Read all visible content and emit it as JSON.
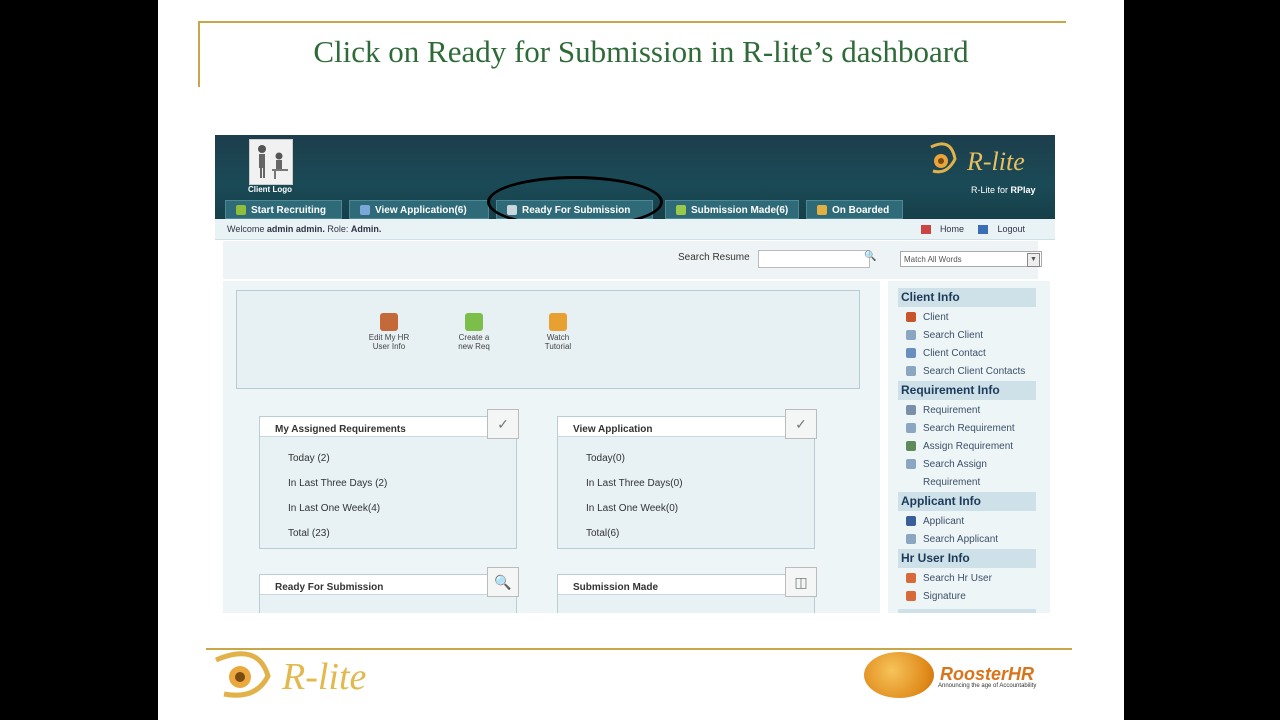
{
  "slide": {
    "title": "Click on Ready for Submission in R-lite’s dashboard"
  },
  "header": {
    "client_logo_label": "Client Logo",
    "brand_name": "R-lite",
    "brand_sub_prefix": "R-Lite for ",
    "brand_sub_bold": "RPlay"
  },
  "tabs": [
    {
      "label": "Start Recruiting",
      "icon": "start-recruiting-icon",
      "color": "#8fbf3a"
    },
    {
      "label": "View Application(6)",
      "icon": "view-application-icon",
      "color": "#7aa8d8"
    },
    {
      "label": "Ready For Submission",
      "icon": "ready-submission-icon",
      "color": "#c9d6dc"
    },
    {
      "label": "Submission Made(6)",
      "icon": "submission-made-icon",
      "color": "#9ac84a"
    },
    {
      "label": "On Boarded",
      "icon": "on-boarded-icon",
      "color": "#e0b040"
    }
  ],
  "welcome": {
    "prefix": "Welcome ",
    "user": "admin admin.",
    "role_label": " Role: ",
    "role": "Admin.",
    "home": "Home",
    "logout": "Logout"
  },
  "search": {
    "label": "Search Resume",
    "value": "",
    "match_option": "Match All Words"
  },
  "quick_links": [
    {
      "line1": "Edit My HR",
      "line2": "User Info",
      "icon": "edit-user-icon",
      "color": "#c46a3a"
    },
    {
      "line1": "Create a",
      "line2": "new Req",
      "icon": "create-req-icon",
      "color": "#7bbf4a"
    },
    {
      "line1": "Watch",
      "line2": "Tutorial",
      "icon": "tutorial-icon",
      "color": "#e8a030"
    }
  ],
  "panels": [
    {
      "title": "My Assigned Requirements",
      "icon": "check-document-icon",
      "rows": [
        "Today (2)",
        "In Last Three Days (2)",
        "In Last One Week(4)",
        "Total (23)"
      ]
    },
    {
      "title": "View Application",
      "icon": "check-icon",
      "rows": [
        "Today(0)",
        "In Last Three Days(0)",
        "In Last One Week(0)",
        "Total(6)"
      ]
    },
    {
      "title": "Ready For Submission",
      "icon": "magnifier-document-icon",
      "rows": []
    },
    {
      "title": "Submission Made",
      "icon": "documents-icon",
      "rows": []
    }
  ],
  "sidebar": {
    "sections": [
      {
        "title": "Client Info",
        "items": [
          {
            "label": "Client",
            "color": "#c8552a"
          },
          {
            "label": "Search Client",
            "color": "#8aa6c0"
          },
          {
            "label": "Client Contact",
            "color": "#6a8fbf"
          },
          {
            "label": "Search Client Contacts",
            "color": "#8aa6c0"
          }
        ]
      },
      {
        "title": "Requirement Info",
        "items": [
          {
            "label": "Requirement",
            "color": "#7a8fa8"
          },
          {
            "label": "Search Requirement",
            "color": "#8aa6c0"
          },
          {
            "label": "Assign Requirement",
            "color": "#5f8a5a"
          },
          {
            "label": "Search Assign",
            "label2": "Requirement",
            "color": "#8aa6c0"
          }
        ]
      },
      {
        "title": "Applicant Info",
        "items": [
          {
            "label": "Applicant",
            "color": "#3a5e9a"
          },
          {
            "label": "Search Applicant",
            "color": "#8aa6c0"
          }
        ]
      },
      {
        "title": "Hr User Info",
        "items": [
          {
            "label": "Search Hr User",
            "color": "#d86a3a"
          },
          {
            "label": "Signature",
            "color": "#d86a3a"
          }
        ]
      }
    ]
  },
  "footer": {
    "left_brand": "R-lite",
    "rooster_main": "Rooster",
    "rooster_hr": "HR",
    "rooster_tagline": "Announcing the age of Accountability"
  }
}
